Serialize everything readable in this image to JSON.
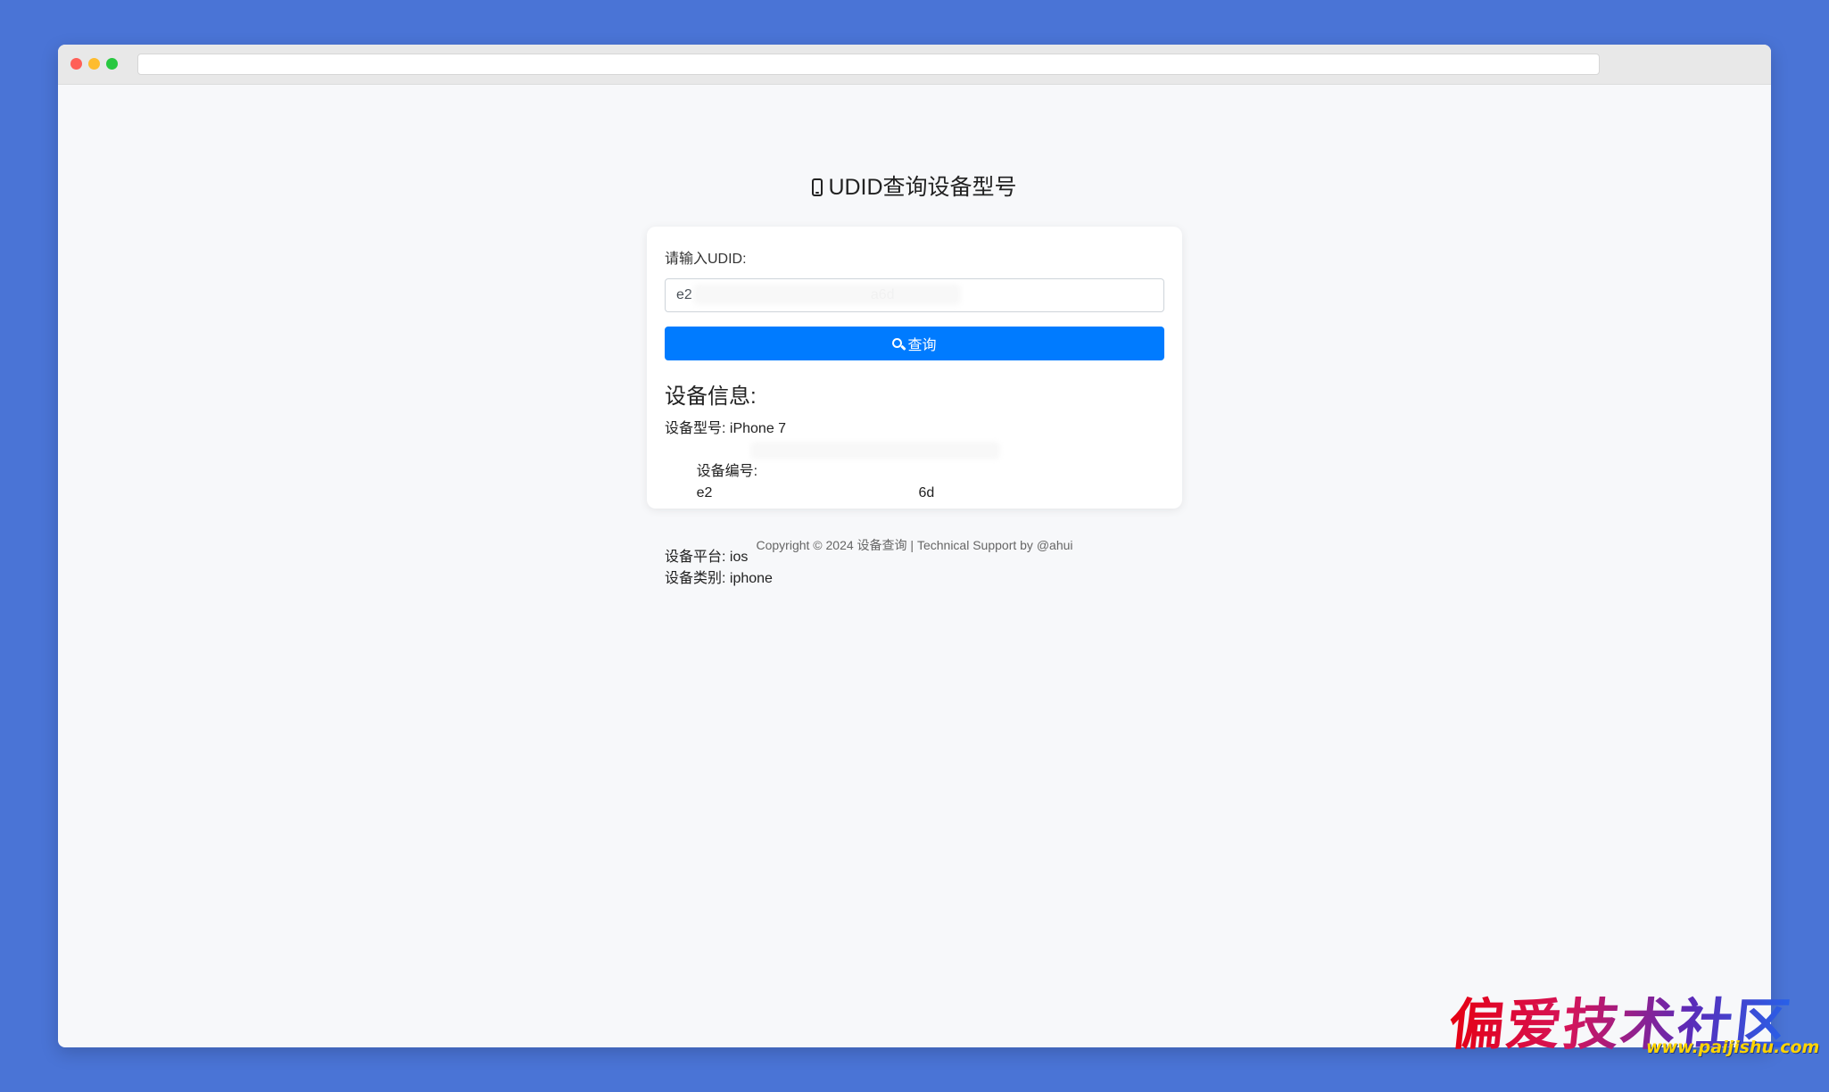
{
  "page": {
    "title": "UDID查询设备型号",
    "title_icon": "mobile-phone-icon"
  },
  "form": {
    "label": "请输入UDID:",
    "input_value": "e2                                             a6d",
    "button_label": "查询",
    "button_icon": "search-icon"
  },
  "info": {
    "heading": "设备信息:",
    "rows": [
      {
        "label": "设备型号:",
        "value": "iPhone 7"
      },
      {
        "label": "设备编号:",
        "value": "e2                                                    6d"
      },
      {
        "label": "设备平台:",
        "value": "ios"
      },
      {
        "label": "设备类别:",
        "value": "iphone"
      }
    ]
  },
  "footer": {
    "text": "Copyright © 2024 设备查询 | Technical Support by @ahui"
  },
  "watermark": {
    "text": "偏爱技术社区",
    "url": "www.paijishu.com"
  },
  "colors": {
    "background": "#4a74d6",
    "button": "#007bff",
    "window": "#f7f8fa"
  }
}
